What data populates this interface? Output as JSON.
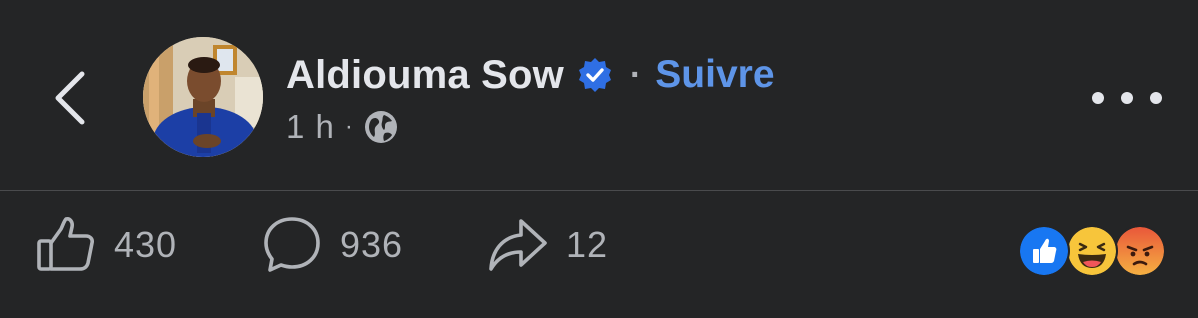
{
  "header": {
    "author_name": "Aldiouma Sow",
    "separator": "·",
    "follow_label": "Suivre",
    "post_time": "1 h",
    "meta_separator": "·",
    "audience_icon": "globe-icon",
    "verified_icon": "verified-badge-icon",
    "back_icon": "chevron-left-icon",
    "more_icon": "more-horizontal-icon"
  },
  "actions": {
    "like": {
      "icon": "thumbs-up-icon",
      "count": "430"
    },
    "comment": {
      "icon": "comment-bubble-icon",
      "count": "936"
    },
    "share": {
      "icon": "share-arrow-icon",
      "count": "12"
    }
  },
  "reactions": [
    "like",
    "haha",
    "angry"
  ],
  "colors": {
    "background": "#242526",
    "text_primary": "#e4e6eb",
    "text_secondary": "#b0b3b8",
    "link_blue": "#5e95e8",
    "verified_blue": "#2f6fe4",
    "divider": "#4a4b4d"
  }
}
